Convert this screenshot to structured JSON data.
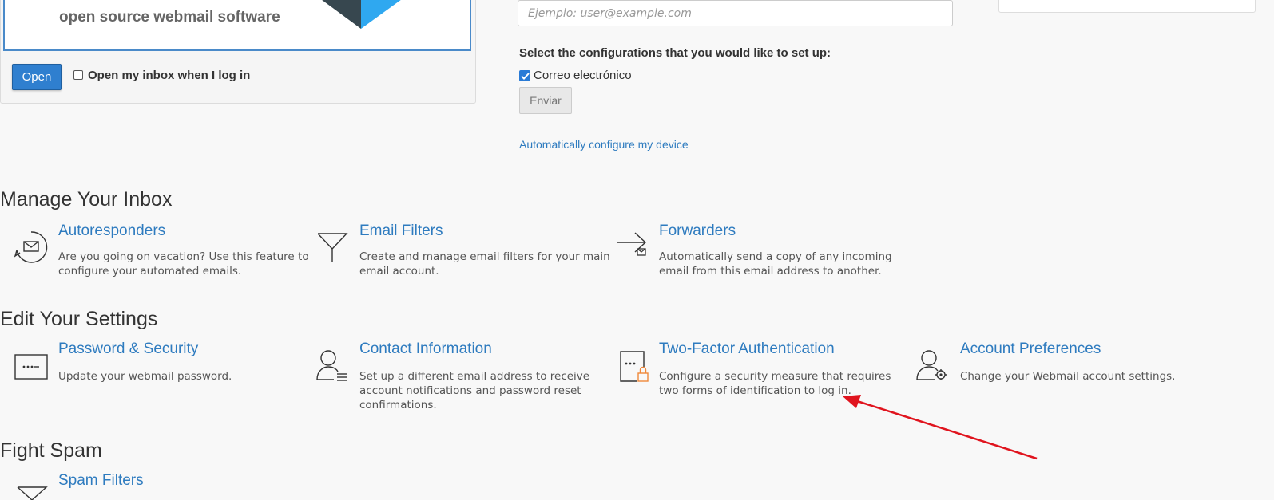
{
  "webmail": {
    "tagline": "open source webmail software",
    "open_label": "Open",
    "open_inbox_label": "Open my inbox when I log in"
  },
  "config": {
    "email_placeholder": "Ejemplo: user@example.com",
    "heading": "Select the configurations that you would like to set up:",
    "option_label": "Correo electrónico",
    "option_checked": true,
    "submit_label": "Enviar",
    "auto_link": "Automatically configure my device"
  },
  "manage_inbox": {
    "title": "Manage Your Inbox",
    "items": [
      {
        "title": "Autoresponders",
        "desc1": "Are you going on vacation? Use this feature to",
        "desc2": "configure your automated emails."
      },
      {
        "title": "Email Filters",
        "desc1": "Create and manage email filters for your main",
        "desc2": "email account."
      },
      {
        "title": "Forwarders",
        "desc1": "Automatically send a copy of any incoming",
        "desc2": "email from this email address to another."
      }
    ]
  },
  "settings": {
    "title": "Edit Your Settings",
    "items": [
      {
        "title": "Password & Security",
        "desc1": "Update your webmail password."
      },
      {
        "title": "Contact Information",
        "desc1": "Set up a different email address to receive",
        "desc2": "account notifications and password reset",
        "desc3": "confirmations."
      },
      {
        "title": "Two-Factor Authentication",
        "desc1": "Configure a security measure that requires",
        "desc2": "two forms of identification to log in."
      },
      {
        "title": "Account Preferences",
        "desc1": "Change your Webmail account settings."
      }
    ]
  },
  "spam": {
    "title": "Fight Spam",
    "items": [
      {
        "title": "Spam Filters"
      }
    ]
  },
  "colors": {
    "link": "#2e7bbf",
    "primary_button": "#2f7fcf",
    "annotation_arrow": "#e0141e",
    "lock_accent": "#f0883a"
  },
  "icons": {
    "autoresponders": "envelope-circle-icon",
    "email_filters": "funnel-icon",
    "forwarders": "forward-arrow-envelope-icon",
    "password": "password-dots-icon",
    "contact": "user-list-icon",
    "two_factor": "device-lock-icon",
    "account_prefs": "user-gear-icon",
    "spam": "funnel-icon"
  }
}
